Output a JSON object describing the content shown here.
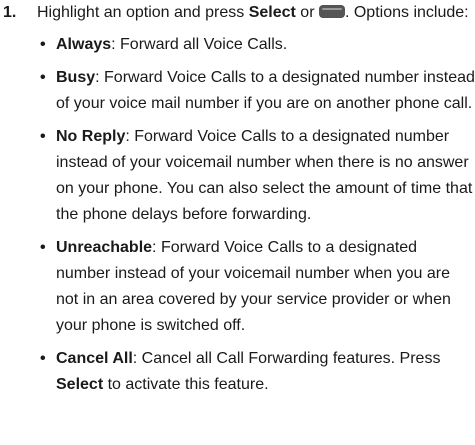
{
  "step": {
    "number": "1.",
    "text_before_select": "Highlight an option and press ",
    "select_label": "Select",
    "text_or": " or ",
    "key_icon": "menu-key-icon",
    "text_after_icon": ". Options include:"
  },
  "options": [
    {
      "name": "Always",
      "desc": ": Forward all Voice Calls."
    },
    {
      "name": "Busy",
      "desc": ": Forward Voice Calls to a designated number instead of your voice mail number if you are on another phone call."
    },
    {
      "name": "No Reply",
      "desc": ": Forward Voice Calls to a designated number instead of your voicemail number when there is no answer on your phone. You can also select the amount of time that the phone delays before forwarding."
    },
    {
      "name": "Unreachable",
      "desc": ": Forward Voice Calls to a designated number instead of your voicemail number when you are not in an area covered by your service provider or when your phone is switched off."
    },
    {
      "name": "Cancel All",
      "desc": ": Cancel all Call Forwarding features. Press ",
      "select_label": "Select",
      "desc_after": " to activate this feature."
    }
  ]
}
